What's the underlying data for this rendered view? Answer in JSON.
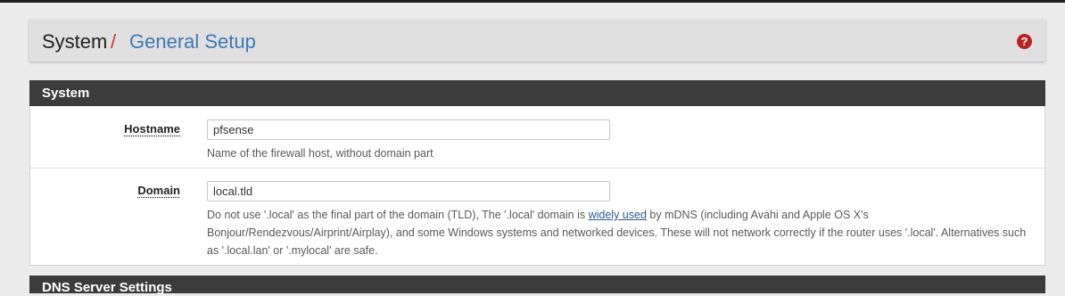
{
  "breadcrumb": {
    "root": "System",
    "separator": "/",
    "current": "General Setup"
  },
  "help_icon": "question-circle-icon",
  "colors": {
    "heading_bg": "#3c3c3c",
    "link": "#3d7ab8",
    "separator": "#cc3a2d",
    "help_icon": "#b52424"
  },
  "panels": {
    "system": {
      "title": "System",
      "hostname": {
        "label": "Hostname",
        "value": "pfsense",
        "help": "Name of the firewall host, without domain part"
      },
      "domain": {
        "label": "Domain",
        "value": "local.tld",
        "help_before": "Do not use '.local' as the final part of the domain (TLD), The '.local' domain is ",
        "help_link": "widely used",
        "help_after": " by mDNS (including Avahi and Apple OS X's Bonjour/Rendezvous/Airprint/Airplay), and some Windows systems and networked devices. These will not network correctly if the router uses '.local'. Alternatives such as '.local.lan' or '.mylocal' are safe."
      }
    },
    "dns": {
      "title": "DNS Server Settings"
    }
  }
}
